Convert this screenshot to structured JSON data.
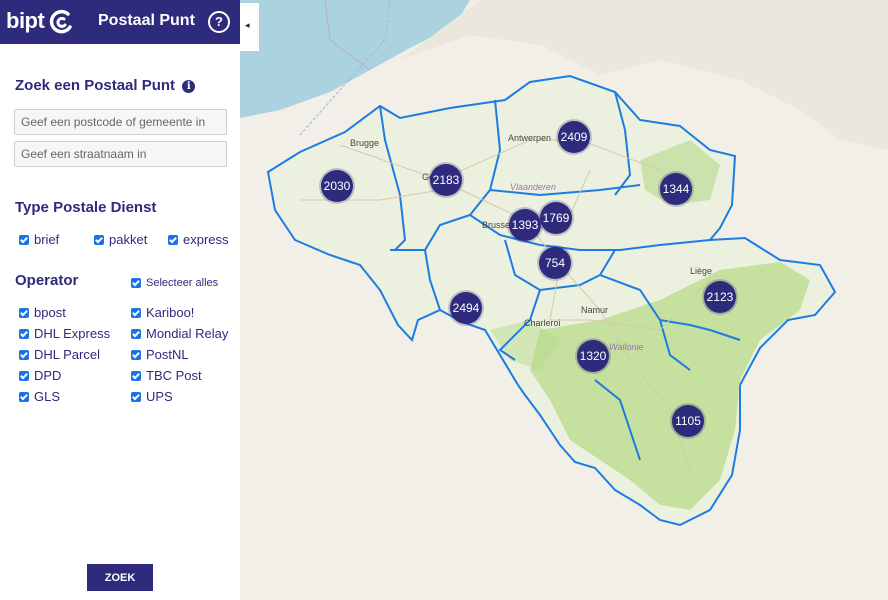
{
  "header": {
    "logo_text": "bipt",
    "title": "Postaal Punt",
    "help_label": "?"
  },
  "collapse_icon": "◂",
  "search": {
    "title": "Zoek een Postaal Punt",
    "info_icon": "i",
    "postcode_placeholder": "Geef een postcode of gemeente in",
    "street_placeholder": "Geef een straatnaam in"
  },
  "service": {
    "title": "Type Postale Dienst",
    "options": [
      "brief",
      "pakket",
      "express"
    ]
  },
  "operator": {
    "title": "Operator",
    "select_all": "Selecteer alles",
    "left": [
      "bpost",
      "DHL Express",
      "DHL Parcel",
      "DPD",
      "GLS"
    ],
    "right": [
      "Kariboo!",
      "Mondial Relay",
      "PostNL",
      "TBC Post",
      "UPS"
    ]
  },
  "zoek_label": "ZOEK",
  "map": {
    "cities": [
      "Brugge",
      "Gent",
      "Antwerpen",
      "Brussel",
      "Vlaanderen",
      "Liège",
      "Charleroi",
      "Namur",
      "Wallonie"
    ],
    "clusters": [
      "2030",
      "2183",
      "2409",
      "1344",
      "1393",
      "1769",
      "754",
      "2494",
      "2123",
      "1320",
      "1105"
    ]
  },
  "colors": {
    "brand": "#2e2a7c",
    "checkbox": "#1a73e8",
    "border": "#1c7ce0",
    "sea": "#aad3df",
    "forest": "#b8d98a",
    "land": "#f2efe9"
  }
}
